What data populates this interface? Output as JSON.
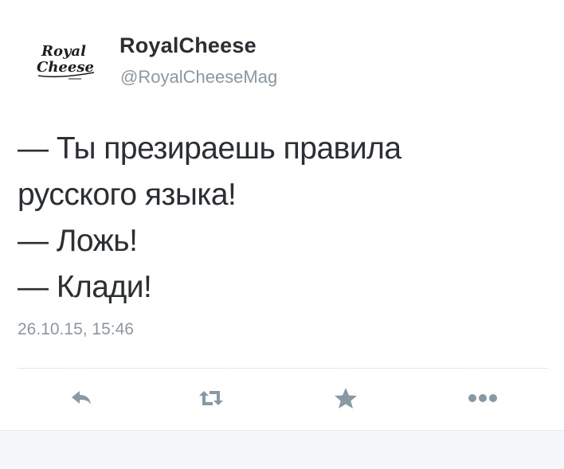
{
  "tweet": {
    "author": {
      "name": "RoyalCheese",
      "handle": "@RoyalCheeseMag",
      "avatar_logo_text": "Royal Cheese"
    },
    "text_lines": [
      "— Ты презираешь правила",
      "русского языка!",
      "— Ложь!",
      "— Клади!"
    ],
    "timestamp": "26.10.15, 15:46"
  },
  "actions": [
    {
      "name": "reply",
      "icon": "reply-icon"
    },
    {
      "name": "retweet",
      "icon": "retweet-icon"
    },
    {
      "name": "favorite",
      "icon": "star-icon"
    },
    {
      "name": "more",
      "icon": "more-dots-icon"
    }
  ],
  "colors": {
    "text": "#292f33",
    "secondary": "#8899a6",
    "icon": "#8899a6",
    "divider": "#e1e8ed",
    "footer_background": "#f5f8fa"
  }
}
